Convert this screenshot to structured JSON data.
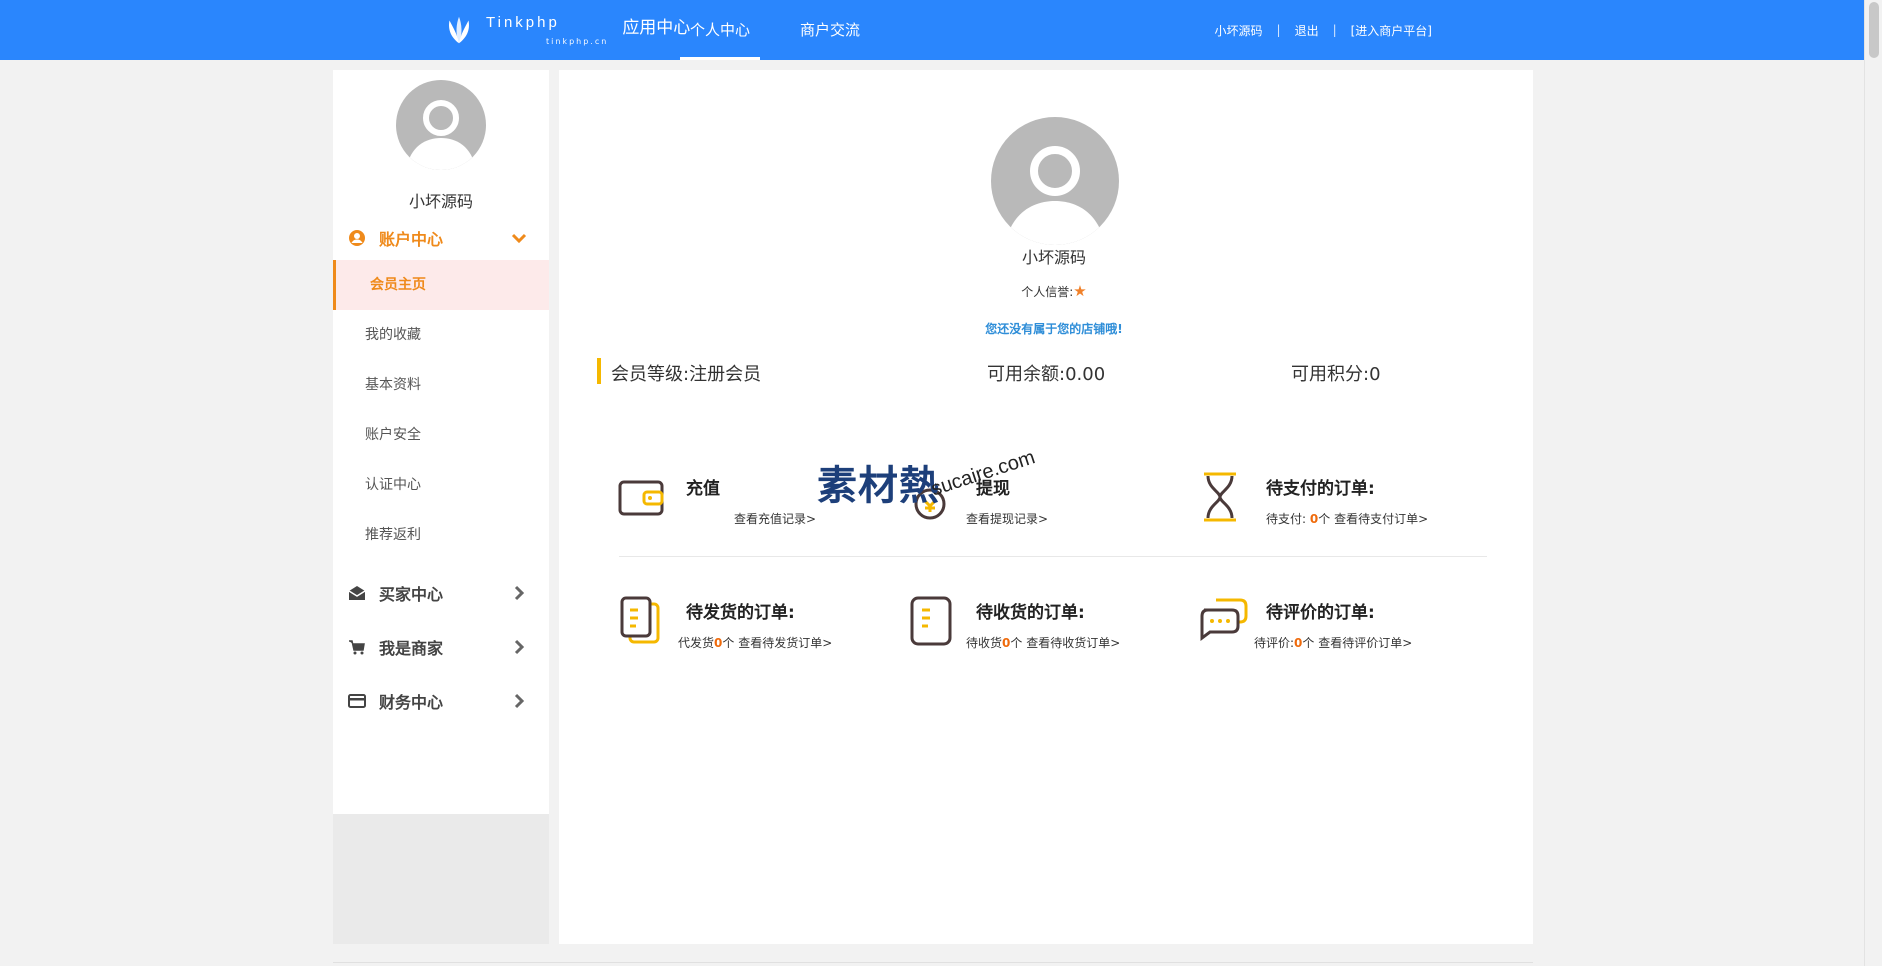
{
  "header": {
    "brand_name": "Tinkphp",
    "brand_domain": "tinkphp.cn",
    "app_center": "应用中心",
    "nav": [
      {
        "label": "个人中心",
        "active": true
      },
      {
        "label": "商户交流",
        "active": false
      }
    ],
    "user_name": "小坏源码",
    "logout": "退出",
    "separator": "|",
    "merchant_link": "[进入商户平台]"
  },
  "sidebar": {
    "user_name": "小坏源码",
    "account_group": "账户中心",
    "items": [
      {
        "label": "会员主页",
        "active": true
      },
      {
        "label": "我的收藏",
        "active": false
      },
      {
        "label": "基本资料",
        "active": false
      },
      {
        "label": "账户安全",
        "active": false
      },
      {
        "label": "认证中心",
        "active": false
      },
      {
        "label": "推荐返利",
        "active": false
      }
    ],
    "groups": [
      {
        "label": "买家中心",
        "icon": "envelope-open-icon"
      },
      {
        "label": "我是商家",
        "icon": "cart-icon"
      },
      {
        "label": "财务中心",
        "icon": "credit-card-icon"
      }
    ]
  },
  "profile": {
    "name": "小坏源码",
    "credit_label": "个人信誉:",
    "credit_star": "★",
    "shop_note": "您还没有属于您的店铺哦!"
  },
  "stats": {
    "level": "会员等级:注册会员",
    "balance": "可用余额:0.00",
    "points": "可用积分:0"
  },
  "cards": {
    "recharge": {
      "title": "充值",
      "link": "查看充值记录>"
    },
    "withdraw": {
      "title": "提现",
      "link": "查看提现记录>"
    },
    "pending_pay": {
      "title": "待支付的订单:",
      "prefix": "待支付:",
      "count": "0",
      "unit": "个",
      "link": "查看待支付订单>"
    },
    "pending_ship": {
      "title": "待发货的订单:",
      "prefix": "代发货",
      "count": "0",
      "unit": "个",
      "link": "查看待发货订单>"
    },
    "pending_receive": {
      "title": "待收货的订单:",
      "prefix": "待收货",
      "count": "0",
      "unit": "个",
      "link": "查看待收货订单>"
    },
    "pending_review": {
      "title": "待评价的订单:",
      "prefix": "待评价:",
      "count": "0",
      "unit": "个",
      "link": "查看待评价订单>"
    }
  },
  "watermark": {
    "text": "素材熱",
    "url": "sucaire.com"
  },
  "colors": {
    "header_blue": "#2a86fd",
    "accent_orange": "#ef8a1b",
    "active_bg": "#fdeaea",
    "stat_bar": "#f5b800",
    "shop_note_blue": "#2f8ed8",
    "icon_dark": "#4a3a3a",
    "icon_yellow": "#f5b800"
  }
}
